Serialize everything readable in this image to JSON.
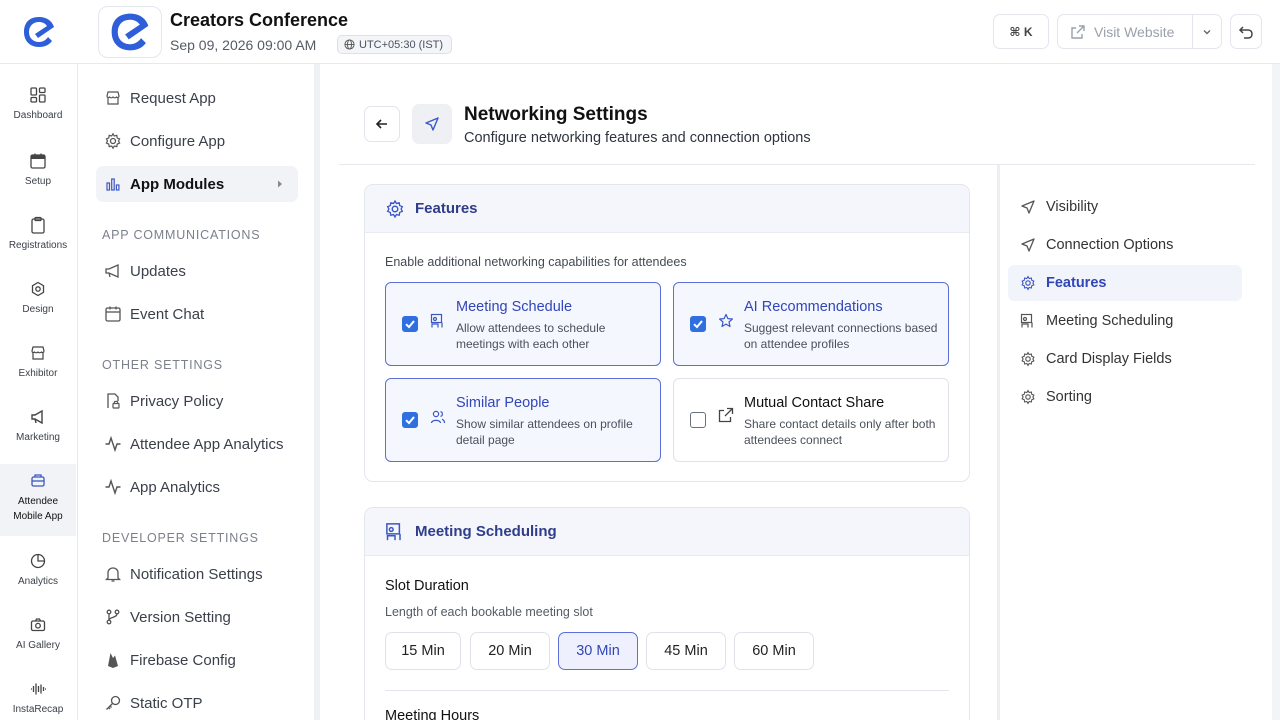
{
  "header": {
    "event_title": "Creators Conference",
    "event_date": "Sep 09, 2026 09:00 AM",
    "timezone": "UTC+05:30 (IST)",
    "shortcut": "⌘ K",
    "visit_website": "Visit Website"
  },
  "rail": {
    "items": [
      {
        "label": "Dashboard",
        "icon": "grid-icon"
      },
      {
        "label": "Setup",
        "icon": "calendar-icon"
      },
      {
        "label": "Registrations",
        "icon": "clipboard-icon"
      },
      {
        "label": "Design",
        "icon": "gear-icon"
      },
      {
        "label": "Exhibitor",
        "icon": "store-icon"
      },
      {
        "label": "Marketing",
        "icon": "megaphone-icon"
      },
      {
        "label": "Attendee Mobile App",
        "icon": "mobile-app-icon"
      },
      {
        "label": "Analytics",
        "icon": "pie-chart-icon"
      },
      {
        "label": "AI Gallery",
        "icon": "camera-icon"
      },
      {
        "label": "InstaRecap",
        "icon": "waveform-icon"
      }
    ]
  },
  "nav": {
    "request_app": "Request App",
    "configure_app": "Configure App",
    "app_modules": "App Modules",
    "section_communications": "APP COMMUNICATIONS",
    "updates": "Updates",
    "event_chat": "Event Chat",
    "section_other": "OTHER SETTINGS",
    "privacy_policy": "Privacy Policy",
    "attendee_app_analytics": "Attendee App Analytics",
    "app_analytics": "App Analytics",
    "section_developer": "DEVELOPER SETTINGS",
    "notification_settings": "Notification Settings",
    "version_setting": "Version Setting",
    "firebase_config": "Firebase Config",
    "static_otp": "Static OTP"
  },
  "page": {
    "title": "Networking Settings",
    "subtitle": "Configure networking features and connection options"
  },
  "features": {
    "heading": "Features",
    "description": "Enable additional networking capabilities for attendees",
    "items": [
      {
        "title": "Meeting Schedule",
        "desc": "Allow attendees to schedule meetings with each other",
        "checked": true
      },
      {
        "title": "AI Recommendations",
        "desc": "Suggest relevant connections based on attendee profiles",
        "checked": true
      },
      {
        "title": "Similar People",
        "desc": "Show similar attendees on profile detail page",
        "checked": true
      },
      {
        "title": "Mutual Contact Share",
        "desc": "Share contact details only after both attendees connect",
        "checked": false
      }
    ]
  },
  "meeting": {
    "heading": "Meeting Scheduling",
    "slot_label": "Slot Duration",
    "slot_desc": "Length of each bookable meeting slot",
    "slots": [
      "15 Min",
      "20 Min",
      "30 Min",
      "45 Min",
      "60 Min"
    ],
    "selected_slot": "30 Min",
    "hours_label": "Meeting Hours"
  },
  "side_nav": {
    "items": [
      "Visibility",
      "Connection Options",
      "Features",
      "Meeting Scheduling",
      "Card Display Fields",
      "Sorting"
    ],
    "active": "Features"
  },
  "colors": {
    "accent": "#3146b8",
    "brand": "#2f5fd8",
    "checkbox": "#2f6fe0"
  }
}
